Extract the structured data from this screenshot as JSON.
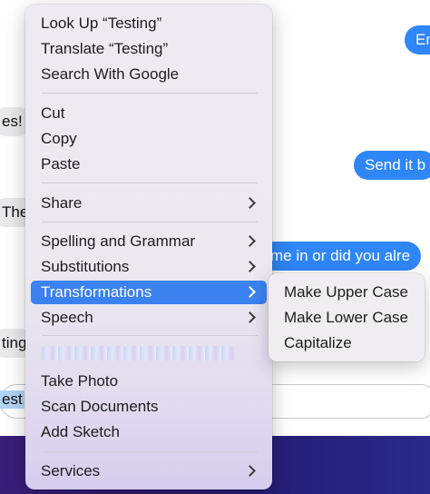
{
  "chat": {
    "bubble_right_top": "Em",
    "bubble_gray_1": "es!",
    "bubble_right_mid": "Send it b",
    "bubble_gray_2": "The",
    "bubble_right_long": "me in or did you alre",
    "bubble_gray_3": "ting",
    "input_text": "est"
  },
  "menu": {
    "items": [
      {
        "label": "Look Up “Testing”"
      },
      {
        "label": "Translate “Testing”"
      },
      {
        "label": "Search With Google"
      },
      {
        "label": "Cut"
      },
      {
        "label": "Copy"
      },
      {
        "label": "Paste"
      },
      {
        "label": "Share"
      },
      {
        "label": "Spelling and Grammar"
      },
      {
        "label": "Substitutions"
      },
      {
        "label": "Transformations"
      },
      {
        "label": "Speech"
      },
      {
        "label": "Take Photo"
      },
      {
        "label": "Scan Documents"
      },
      {
        "label": "Add Sketch"
      },
      {
        "label": "Services"
      }
    ]
  },
  "submenu": {
    "items": [
      {
        "label": "Make Upper Case"
      },
      {
        "label": "Make Lower Case"
      },
      {
        "label": "Capitalize"
      }
    ]
  },
  "colors": {
    "accent": "#3b82f0",
    "bubble_blue": "#2f86f6"
  }
}
